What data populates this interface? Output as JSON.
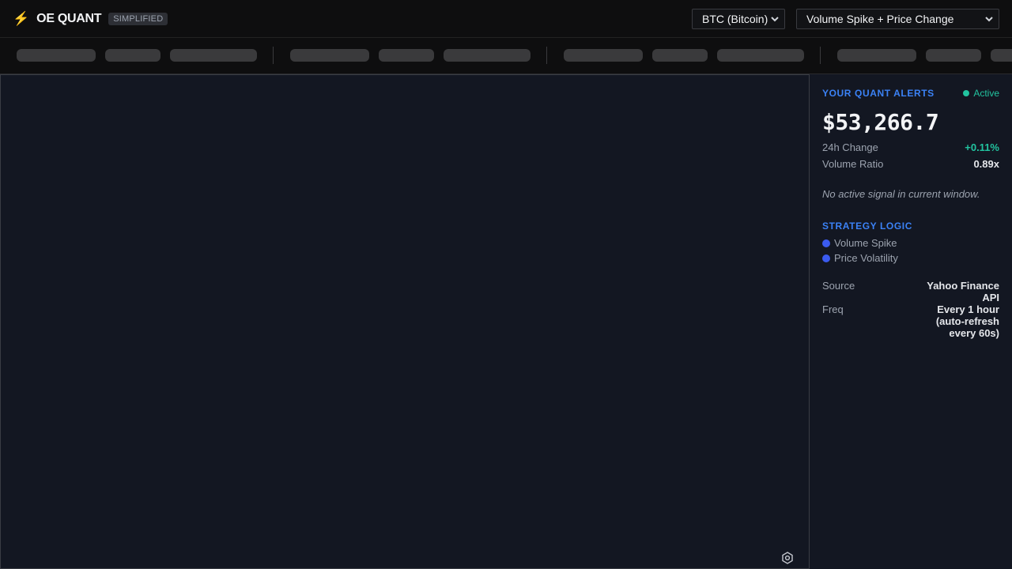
{
  "header": {
    "title": "OE QUANT",
    "badge": "SIMPLIFIED",
    "asset_select": "BTC (Bitcoin)",
    "strategy_select": "Volume Spike + Price Change"
  },
  "sidebar": {
    "alerts_title": "YOUR QUANT ALERTS",
    "status": "Active",
    "price": "$53,266.7",
    "change_label": "24h Change",
    "change_value": "+0.11%",
    "ratio_label": "Volume Ratio",
    "ratio_value": "0.89x",
    "signal_text": "No active signal in current window.",
    "logic_title": "STRATEGY LOGIC",
    "logic_items": [
      "Volume Spike",
      "Price Volatility"
    ],
    "source_label": "Source",
    "source_value": "Yahoo Finance API",
    "freq_label": "Freq",
    "freq_value": "Every 1 hour (auto-refresh every 60s)"
  },
  "icons": {
    "logo": "lightning-bolt-icon",
    "chevron": "chevron-down-icon",
    "chart_settings": "gear-icon"
  },
  "colors": {
    "accent_blue": "#3b82f6",
    "positive_green": "#22c4a0",
    "bolt_yellow": "#f5b300"
  }
}
